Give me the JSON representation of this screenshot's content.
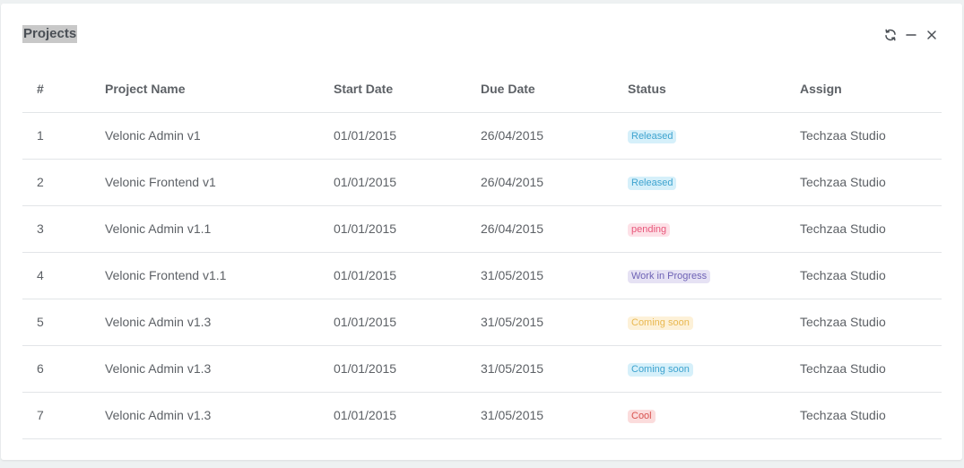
{
  "panel": {
    "title": "Projects",
    "tools": [
      {
        "name": "refresh-icon"
      },
      {
        "name": "minimize-icon"
      },
      {
        "name": "close-icon"
      }
    ]
  },
  "table": {
    "headers": [
      "#",
      "Project Name",
      "Start Date",
      "Due Date",
      "Status",
      "Assign"
    ],
    "rows": [
      {
        "num": "1",
        "name": "Velonic Admin v1",
        "start": "01/01/2015",
        "due": "26/04/2015",
        "status": "Released",
        "status_bg": "#d6f0fa",
        "status_fg": "#3ea3cf",
        "assign": "Techzaa Studio"
      },
      {
        "num": "2",
        "name": "Velonic Frontend v1",
        "start": "01/01/2015",
        "due": "26/04/2015",
        "status": "Released",
        "status_bg": "#d6f0fa",
        "status_fg": "#3ea3cf",
        "assign": "Techzaa Studio"
      },
      {
        "num": "3",
        "name": "Velonic Admin v1.1",
        "start": "01/01/2015",
        "due": "26/04/2015",
        "status": "pending",
        "status_bg": "#fde1e7",
        "status_fg": "#e8577b",
        "assign": "Techzaa Studio"
      },
      {
        "num": "4",
        "name": "Velonic Frontend v1.1",
        "start": "01/01/2015",
        "due": "31/05/2015",
        "status": "Work in Progress",
        "status_bg": "#e6e2f4",
        "status_fg": "#6e62b5",
        "assign": "Techzaa Studio"
      },
      {
        "num": "5",
        "name": "Velonic Admin v1.3",
        "start": "01/01/2015",
        "due": "31/05/2015",
        "status": "Coming soon",
        "status_bg": "#fdf1d8",
        "status_fg": "#e9b850",
        "assign": "Techzaa Studio"
      },
      {
        "num": "6",
        "name": "Velonic Admin v1.3",
        "start": "01/01/2015",
        "due": "31/05/2015",
        "status": "Coming soon",
        "status_bg": "#d6f0fa",
        "status_fg": "#3ea3cf",
        "assign": "Techzaa Studio"
      },
      {
        "num": "7",
        "name": "Velonic Admin v1.3",
        "start": "01/01/2015",
        "due": "31/05/2015",
        "status": "Cool",
        "status_bg": "#fbdcdc",
        "status_fg": "#d9534f",
        "assign": "Techzaa Studio"
      }
    ]
  }
}
